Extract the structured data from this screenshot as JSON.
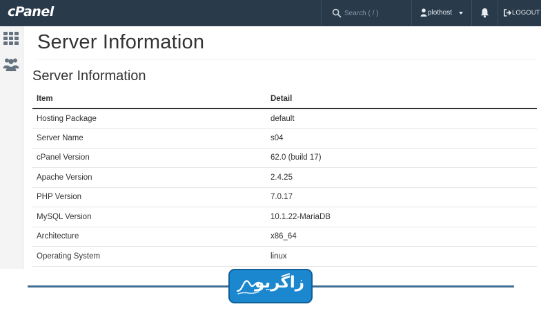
{
  "header": {
    "logo": "cPanel",
    "search_placeholder": "Search ( / )",
    "username": "plothost",
    "logout_label": "LOGOUT"
  },
  "sidebar": {
    "items": [
      {
        "icon": "grid-icon"
      },
      {
        "icon": "users-icon"
      }
    ]
  },
  "main": {
    "page_title": "Server Information",
    "section_title": "Server Information",
    "table": {
      "headers": [
        "Item",
        "Detail"
      ],
      "rows": [
        [
          "Hosting Package",
          "default"
        ],
        [
          "Server Name",
          "s04"
        ],
        [
          "cPanel Version",
          "62.0 (build 17)"
        ],
        [
          "Apache Version",
          "2.4.25"
        ],
        [
          "PHP Version",
          "7.0.17"
        ],
        [
          "MySQL Version",
          "10.1.22-MariaDB"
        ],
        [
          "Architecture",
          "x86_64"
        ],
        [
          "Operating System",
          "linux"
        ]
      ]
    }
  },
  "banner": {
    "text": "زاگریو"
  },
  "colors": {
    "topbar": "#293a4a",
    "banner_blue": "#1b87cf",
    "banner_line": "#3f6f95"
  }
}
